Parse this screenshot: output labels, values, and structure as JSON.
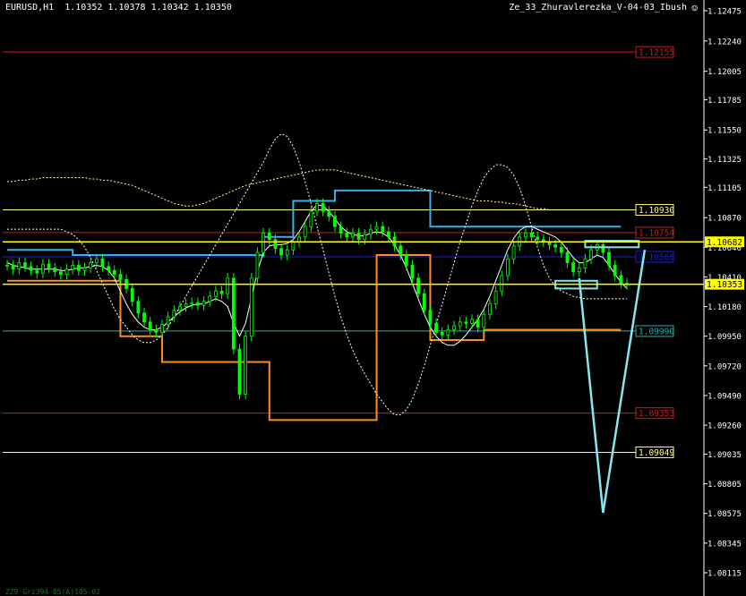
{
  "header": {
    "symbol": "EURUSD,H1",
    "ohlc": "1.10352 1.10378 1.10342 1.10350",
    "indicator": "Ze_33_Zhuravlerezka_V-04-03_Ibush",
    "smiley_icon": "smiley-icon"
  },
  "footer": {
    "text": "ZZ9 Grz394 85(A)105-02"
  },
  "colors": {
    "background": "#000000",
    "candle": "#00ff00",
    "axis_text": "#ffffff",
    "current_price": "#ffff00",
    "orange": "#ff8c1a",
    "cyan": "#3ab0e8",
    "red_level": "#c81e1e",
    "arrow": "#87e6f0"
  },
  "chart_data": {
    "type": "candlestick",
    "y_ticks": [
      "1.12475",
      "1.12240",
      "1.12005",
      "1.11785",
      "1.11550",
      "1.11325",
      "1.11105",
      "1.10870",
      "1.10640",
      "1.10410",
      "1.10180",
      "1.09950",
      "1.09720",
      "1.09490",
      "1.09260",
      "1.09035",
      "1.08805",
      "1.08575",
      "1.08345",
      "1.08115"
    ],
    "ylim": [
      1.08,
      1.1258
    ],
    "grid": false,
    "levels": [
      {
        "label": "1.12155",
        "value": 1.12155,
        "color": "#c81e1e"
      },
      {
        "label": "1.10930",
        "value": 1.1093,
        "color": "#ffff80"
      },
      {
        "label": "1.10754",
        "value": 1.10754,
        "color": "#c81e1e"
      },
      {
        "label": "1.10566",
        "value": 1.10566,
        "color": "#1e1ed2"
      },
      {
        "label": "1.09990",
        "value": 1.0999,
        "color": "#20b2aa"
      },
      {
        "label": "1.09353",
        "value": 1.09353,
        "color": "#c81e1e"
      },
      {
        "label": "1.09049",
        "value": 1.09049,
        "color": "#ffff80"
      }
    ],
    "current_prices": [
      {
        "label": "1.10682",
        "value": 1.10682
      },
      {
        "label": "1.10353",
        "value": 1.10353
      }
    ],
    "series": [
      {
        "kind": "candles",
        "values": [
          1.105,
          1.1047,
          1.1052,
          1.1049,
          1.1046,
          1.1044,
          1.1051,
          1.1048,
          1.1045,
          1.1043,
          1.1047,
          1.105,
          1.1046,
          1.1048,
          1.1052,
          1.1055,
          1.1049,
          1.1046,
          1.1043,
          1.1039,
          1.1032,
          1.1022,
          1.1013,
          1.1006,
          1.1,
          1.0998,
          1.1004,
          1.101,
          1.1015,
          1.1018,
          1.102,
          1.1021,
          1.1019,
          1.1022,
          1.1026,
          1.103,
          1.1028,
          1.104,
          1.0985,
          1.095,
          1.0995,
          1.104,
          1.106,
          1.1075,
          1.107,
          1.1063,
          1.1058,
          1.1062,
          1.1068,
          1.1072,
          1.108,
          1.1092,
          1.1098,
          1.1092,
          1.1088,
          1.108,
          1.1075,
          1.1072,
          1.1075,
          1.107,
          1.1074,
          1.1078,
          1.108,
          1.1076,
          1.1072,
          1.1065,
          1.1058,
          1.105,
          1.104,
          1.1028,
          1.1015,
          1.1005,
          1.0998,
          1.0996,
          1.1,
          1.1003,
          1.1006,
          1.1005,
          1.1008,
          1.1002,
          1.1012,
          1.102,
          1.103,
          1.1042,
          1.1055,
          1.1065,
          1.1072,
          1.1075,
          1.1072,
          1.107,
          1.1068,
          1.1066,
          1.1064,
          1.106,
          1.1052,
          1.1045,
          1.1048,
          1.1055,
          1.1062,
          1.1066,
          1.106,
          1.105,
          1.1042,
          1.1036,
          1.1035
        ]
      },
      {
        "kind": "line",
        "name": "",
        "color": "#ff8c1a",
        "style": "step",
        "values": [
          1.1038,
          1.1038,
          1.1038,
          1.1038,
          1.1038,
          1.1038,
          1.1038,
          1.1038,
          1.1038,
          1.1038,
          1.1038,
          1.1038,
          1.1038,
          1.1038,
          1.1038,
          1.1038,
          1.1038,
          1.1038,
          1.1038,
          1.0995,
          1.0995,
          1.0995,
          1.0995,
          1.0995,
          1.0995,
          1.0995,
          1.0975,
          1.0975,
          1.0975,
          1.0975,
          1.0975,
          1.0975,
          1.0975,
          1.0975,
          1.0975,
          1.0975,
          1.0975,
          1.0975,
          1.0975,
          1.0975,
          1.0975,
          1.0975,
          1.0975,
          1.0975,
          1.093,
          1.093,
          1.093,
          1.093,
          1.093,
          1.093,
          1.093,
          1.093,
          1.093,
          1.093,
          1.093,
          1.093,
          1.093,
          1.093,
          1.093,
          1.093,
          1.093,
          1.093,
          1.1058,
          1.1058,
          1.1058,
          1.1058,
          1.1058,
          1.1058,
          1.1058,
          1.1058,
          1.1058,
          1.0992,
          1.0992,
          1.0992,
          1.0992,
          1.0992,
          1.0992,
          1.0992,
          1.0992,
          1.0992,
          1.1,
          1.1,
          1.1,
          1.1,
          1.1,
          1.1,
          1.1,
          1.1,
          1.1,
          1.1,
          1.1,
          1.1,
          1.1,
          1.1,
          1.1,
          1.1,
          1.1,
          1.1,
          1.1,
          1.1,
          1.1,
          1.1,
          1.1,
          1.1
        ]
      },
      {
        "kind": "line",
        "name": "",
        "color": "#3ab0e8",
        "style": "step",
        "values": [
          1.1062,
          1.1062,
          1.1062,
          1.1062,
          1.1062,
          1.1062,
          1.1062,
          1.1062,
          1.1062,
          1.1062,
          1.1062,
          1.1058,
          1.1058,
          1.1058,
          1.1058,
          1.1058,
          1.1058,
          1.1058,
          1.1058,
          1.1058,
          1.1058,
          1.1058,
          1.1058,
          1.1058,
          1.1058,
          1.1058,
          1.1058,
          1.1058,
          1.1058,
          1.1058,
          1.1058,
          1.1058,
          1.1058,
          1.1058,
          1.1058,
          1.1058,
          1.1058,
          1.1058,
          1.1058,
          1.1058,
          1.1058,
          1.1058,
          1.1058,
          1.1072,
          1.1072,
          1.1072,
          1.1072,
          1.1072,
          1.11,
          1.11,
          1.11,
          1.11,
          1.11,
          1.11,
          1.11,
          1.1108,
          1.1108,
          1.1108,
          1.1108,
          1.1108,
          1.1108,
          1.1108,
          1.1108,
          1.1108,
          1.1108,
          1.1108,
          1.1108,
          1.1108,
          1.1108,
          1.1108,
          1.1108,
          1.108,
          1.108,
          1.108,
          1.108,
          1.108,
          1.108,
          1.108,
          1.108,
          1.108,
          1.108,
          1.108,
          1.108,
          1.108,
          1.108,
          1.108,
          1.108,
          1.108,
          1.108,
          1.108,
          1.108,
          1.108,
          1.108,
          1.108,
          1.108,
          1.108,
          1.108,
          1.108,
          1.108,
          1.108,
          1.108,
          1.108,
          1.108,
          1.108
        ]
      },
      {
        "kind": "line",
        "name": "",
        "color": "#ffffff",
        "style": "solid",
        "values": [
          1.1052,
          1.105,
          1.1049,
          1.1048,
          1.1047,
          1.1047,
          1.1047,
          1.1047,
          1.1047,
          1.1046,
          1.1046,
          1.1047,
          1.1048,
          1.1048,
          1.1049,
          1.105,
          1.1049,
          1.1046,
          1.104,
          1.103,
          1.102,
          1.1012,
          1.1006,
          1.1002,
          1.1,
          1.1,
          1.1002,
          1.1006,
          1.101,
          1.1014,
          1.1017,
          1.1019,
          1.102,
          1.102,
          1.1022,
          1.1024,
          1.1022,
          1.1018,
          1.1005,
          1.0995,
          1.1005,
          1.1025,
          1.1045,
          1.106,
          1.1065,
          1.1066,
          1.1066,
          1.1067,
          1.107,
          1.1076,
          1.1084,
          1.1092,
          1.1097,
          1.1096,
          1.1092,
          1.1086,
          1.108,
          1.1076,
          1.1074,
          1.1073,
          1.1073,
          1.1075,
          1.1076,
          1.1075,
          1.1072,
          1.1066,
          1.1058,
          1.1048,
          1.1036,
          1.1024,
          1.1012,
          1.1002,
          1.0995,
          1.099,
          1.0988,
          1.0988,
          1.0991,
          1.0996,
          1.1002,
          1.1008,
          1.1016,
          1.1026,
          1.1038,
          1.105,
          1.1062,
          1.1071,
          1.1077,
          1.108,
          1.108,
          1.1078,
          1.1076,
          1.1074,
          1.1072,
          1.1068,
          1.1062,
          1.1056,
          1.1052,
          1.1052,
          1.1055,
          1.1058,
          1.1056,
          1.105,
          1.1043,
          1.1037,
          1.1032
        ]
      },
      {
        "kind": "line",
        "name": "",
        "color": "#ffffa0",
        "style": "dashed",
        "values": [
          1.1115,
          1.1115,
          1.1116,
          1.1116,
          1.1117,
          1.1117,
          1.1118,
          1.1118,
          1.1118,
          1.1118,
          1.1118,
          1.1118,
          1.1118,
          1.1118,
          1.1117,
          1.1117,
          1.1116,
          1.1116,
          1.1115,
          1.1114,
          1.1113,
          1.1112,
          1.111,
          1.1108,
          1.1106,
          1.1104,
          1.1102,
          1.11,
          1.1098,
          1.1097,
          1.1096,
          1.1096,
          1.1097,
          1.1098,
          1.11,
          1.1102,
          1.1104,
          1.1106,
          1.1108,
          1.111,
          1.1112,
          1.1113,
          1.1114,
          1.1115,
          1.1116,
          1.1117,
          1.1118,
          1.1119,
          1.112,
          1.1121,
          1.1122,
          1.1123,
          1.1124,
          1.1124,
          1.1124,
          1.1124,
          1.1123,
          1.1122,
          1.1121,
          1.112,
          1.1119,
          1.1118,
          1.1117,
          1.1116,
          1.1115,
          1.1114,
          1.1113,
          1.1112,
          1.1111,
          1.111,
          1.1109,
          1.1108,
          1.1107,
          1.1106,
          1.1105,
          1.1104,
          1.1103,
          1.1102,
          1.1101,
          1.11,
          1.11,
          1.11,
          1.1099,
          1.1099,
          1.1098,
          1.1098,
          1.1097,
          1.1096,
          1.1095,
          1.1094,
          1.1094,
          1.1093,
          1.1093,
          1.1093,
          1.1093,
          1.1093,
          1.1093,
          1.1093,
          1.1093,
          1.1093,
          1.1093,
          1.1093,
          1.1093
        ]
      },
      {
        "kind": "line",
        "name": "",
        "color": "#ffffff",
        "style": "dashed",
        "values": [
          1.1078,
          1.1078,
          1.1078,
          1.1078,
          1.1078,
          1.1078,
          1.1078,
          1.1078,
          1.1078,
          1.1078,
          1.1076,
          1.1074,
          1.107,
          1.1064,
          1.1056,
          1.1046,
          1.1036,
          1.1026,
          1.1016,
          1.1008,
          1.1002,
          1.0996,
          1.0992,
          1.099,
          1.099,
          1.0992,
          1.0996,
          1.1002,
          1.101,
          1.1018,
          1.1026,
          1.1034,
          1.1042,
          1.105,
          1.1058,
          1.1066,
          1.1074,
          1.1082,
          1.109,
          1.1098,
          1.1106,
          1.1114,
          1.1122,
          1.113,
          1.114,
          1.1148,
          1.1152,
          1.115,
          1.1142,
          1.113,
          1.1115,
          1.1098,
          1.108,
          1.1062,
          1.1044,
          1.1026,
          1.101,
          1.0996,
          1.0984,
          1.0974,
          1.0966,
          1.0958,
          1.095,
          1.0944,
          1.0938,
          1.0934,
          1.0934,
          1.0938,
          1.0946,
          1.0958,
          1.0972,
          1.0988,
          1.1004,
          1.102,
          1.1036,
          1.1052,
          1.1068,
          1.1082,
          1.1096,
          1.1108,
          1.1118,
          1.1124,
          1.1128,
          1.1128,
          1.1126,
          1.112,
          1.111,
          1.1096,
          1.108,
          1.1064,
          1.105,
          1.104,
          1.1034,
          1.103,
          1.1028,
          1.1026,
          1.1025,
          1.1024,
          1.1024,
          1.1024,
          1.1024,
          1.1024,
          1.1024,
          1.1024,
          1.1024
        ]
      }
    ],
    "annotations": [
      {
        "type": "arrow",
        "color": "#87e6f0",
        "from_index": 96,
        "from_value": 1.104,
        "to_index": 100,
        "to_value": 1.0858
      },
      {
        "type": "arrow",
        "color": "#87e6f0",
        "from_index": 100,
        "from_value": 1.0858,
        "to_index": 107,
        "to_value": 1.1062
      },
      {
        "type": "box",
        "color": "#87e6f0",
        "index_start": 92,
        "index_end": 99,
        "value_top": 1.1038,
        "value_bottom": 1.1032
      },
      {
        "type": "box",
        "color": "#87e6f0",
        "index_start": 97,
        "index_end": 106,
        "value_top": 1.1069,
        "value_bottom": 1.1064
      }
    ]
  }
}
